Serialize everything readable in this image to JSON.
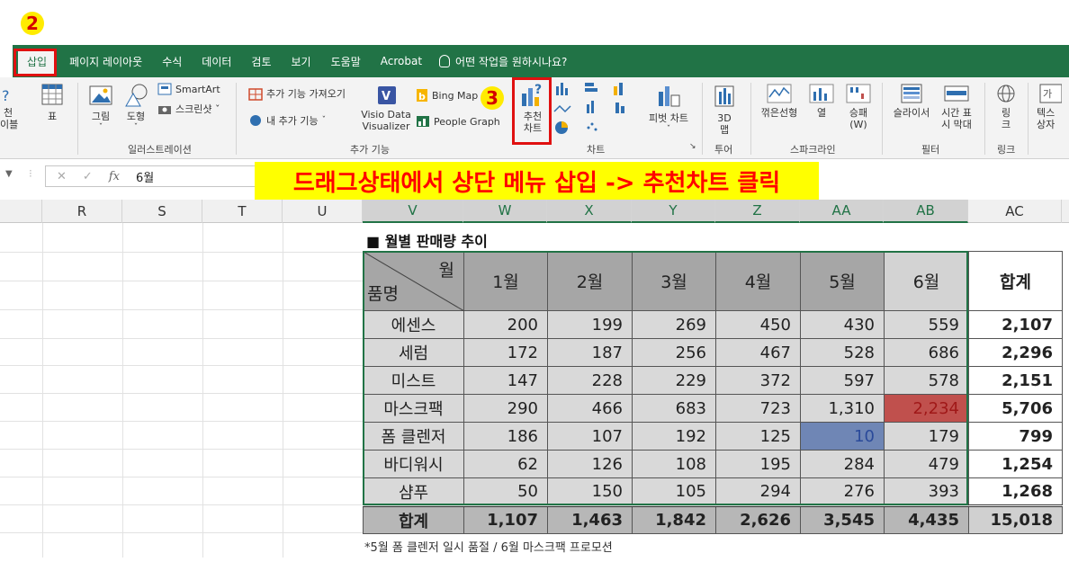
{
  "steps": {
    "two": "2",
    "three": "3"
  },
  "tabs": {
    "insert": "삽입",
    "page_layout": "페이지 레이아웃",
    "formulas": "수식",
    "data": "데이터",
    "review": "검토",
    "view": "보기",
    "help": "도움말",
    "acrobat": "Acrobat",
    "tell_me": "어떤 작업을 원하시나요?"
  },
  "ribbon": {
    "partial_left": "천",
    "partial_left2": "이블",
    "table": "표",
    "picture": "그림",
    "shapes": "도형",
    "smartart": "SmartArt",
    "screenshot": "스크린샷 ˇ",
    "get_addins": "추가 기능 가져오기",
    "my_addins": "내 추가 기능",
    "visio_line1": "Visio Data",
    "visio_line2": "Visualizer",
    "bing_maps": "Bing Map",
    "people_graph": "People Graph",
    "recommended_line1": "추천",
    "recommended_line2": "차트",
    "pivot_chart": "피벗 차트",
    "map3d_line1": "3D",
    "map3d_line2": "맵",
    "line": "꺾은선형",
    "column": "열",
    "winloss_line1": "승패",
    "winloss_line2": "(W)",
    "slicer": "슬라이서",
    "timeline_line1": "시간 표",
    "timeline_line2": "시 막대",
    "link_line1": "링",
    "link_line2": "크",
    "textbox_line1": "텍스",
    "textbox_line2": "상자",
    "groups": {
      "illustrations": "일러스트레이션",
      "addins": "추가 기능",
      "charts": "차트",
      "tours": "투어",
      "sparklines": "스파크라인",
      "filters": "필터",
      "links": "링크"
    }
  },
  "formula_bar": {
    "value": "6월",
    "fx": "fx"
  },
  "banner": "드래그상태에서 상단 메뉴 삽입 -> 추천차트 클릭",
  "columns": [
    "R",
    "S",
    "T",
    "U",
    "V",
    "W",
    "X",
    "Y",
    "Z",
    "AA",
    "AB",
    "AC"
  ],
  "sheet_title": "■ 월별 판매량 추이",
  "table": {
    "corner_top": "월",
    "corner_bottom": "품명",
    "months": [
      "1월",
      "2월",
      "3월",
      "4월",
      "5월",
      "6월"
    ],
    "total_header": "합계",
    "rows": [
      {
        "name": "에센스",
        "values": [
          "200",
          "199",
          "269",
          "450",
          "430",
          "559"
        ],
        "total": "2,107"
      },
      {
        "name": "세럼",
        "values": [
          "172",
          "187",
          "256",
          "467",
          "528",
          "686"
        ],
        "total": "2,296"
      },
      {
        "name": "미스트",
        "values": [
          "147",
          "228",
          "229",
          "372",
          "597",
          "578"
        ],
        "total": "2,151"
      },
      {
        "name": "마스크팩",
        "values": [
          "290",
          "466",
          "683",
          "723",
          "1,310",
          "2,234"
        ],
        "total": "5,706"
      },
      {
        "name": "폼 클렌저",
        "values": [
          "186",
          "107",
          "192",
          "125",
          "10",
          "179"
        ],
        "total": "799"
      },
      {
        "name": "바디워시",
        "values": [
          "62",
          "126",
          "108",
          "195",
          "284",
          "479"
        ],
        "total": "1,254"
      },
      {
        "name": "샴푸",
        "values": [
          "50",
          "150",
          "105",
          "294",
          "276",
          "393"
        ],
        "total": "1,268"
      }
    ],
    "footer": {
      "label": "합계",
      "values": [
        "1,107",
        "1,463",
        "1,842",
        "2,626",
        "3,545",
        "4,435"
      ],
      "total": "15,018"
    }
  },
  "footnote": "*5월 폼 클렌저 일시 품절 / 6월 마스크팩 프로모션",
  "colors": {
    "excel_green": "#217346",
    "highlight_red": "#c0504d",
    "highlight_blue": "#6f86b5",
    "banner_yellow": "#ffff00"
  }
}
